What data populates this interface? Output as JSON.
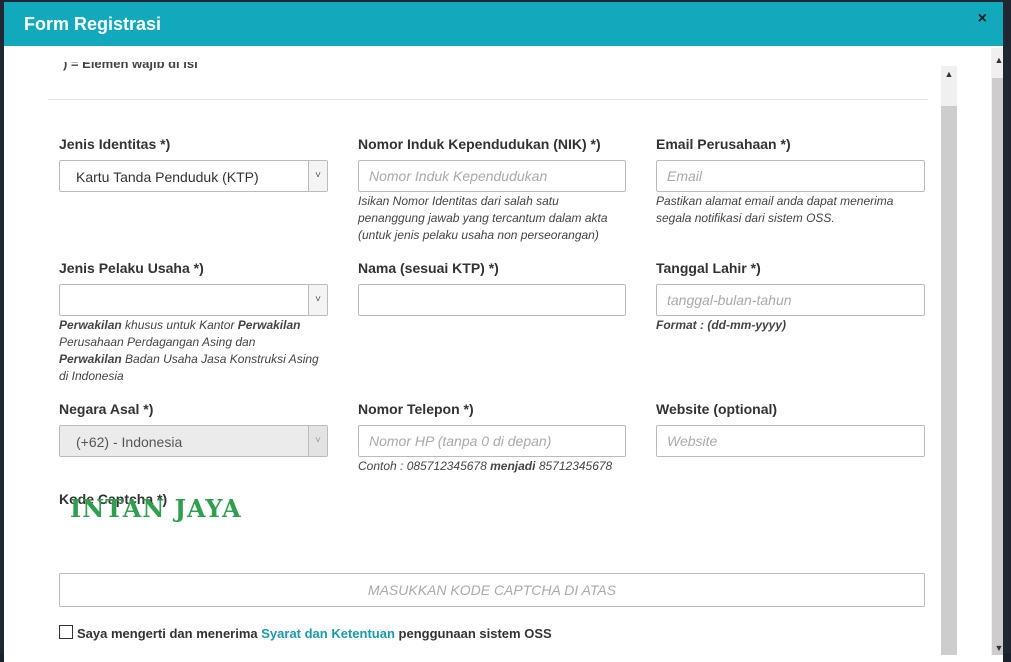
{
  "modal": {
    "title": "Form Registrasi",
    "close_icon": "close-icon",
    "close_glyph": "×"
  },
  "note_top": ") = Elemen wajib di isi",
  "fields": {
    "jenis_identitas": {
      "label": "Jenis Identitas *)",
      "value": "Kartu Tanda Penduduk (KTP)"
    },
    "nik": {
      "label": "Nomor Induk Kependudukan (NIK) *)",
      "placeholder": "Nomor Induk Kependudukan",
      "help": [
        "Isikan Nomor Identitas dari salah satu",
        "penanggung jawab yang tercantum dalam akta",
        "(untuk jenis pelaku usaha non perseorangan)"
      ]
    },
    "email": {
      "label": "Email Perusahaan *)",
      "placeholder": "Email",
      "help": [
        "Pastikan alamat email anda dapat menerima",
        "segala notifikasi dari sistem OSS."
      ]
    },
    "jenis_pelaku": {
      "label": "Jenis Pelaku Usaha *)",
      "value": "",
      "help_bold_1": "Perwakilan",
      "help_1": " khusus untuk Kantor ",
      "help_bold_2": "Perwakilan",
      "help_2": "Perusahaan Perdagangan Asing dan",
      "help_bold_3": "Perwakilan",
      "help_3": " Badan Usaha Jasa Konstruksi Asing",
      "help_4": "di Indonesia"
    },
    "nama": {
      "label": "Nama (sesuai KTP) *)",
      "placeholder": ""
    },
    "tanggal_lahir": {
      "label": "Tanggal Lahir *)",
      "placeholder": "tanggal-bulan-tahun",
      "help": "Format : (dd-mm-yyyy)"
    },
    "negara": {
      "label": "Negara Asal *)",
      "value": "(+62) - Indonesia"
    },
    "telepon": {
      "label": "Nomor Telepon *)",
      "placeholder": "Nomor HP (tanpa 0 di depan)",
      "help_a": "Contoh : 085712345678 ",
      "help_bold": "menjadi",
      "help_b": " 85712345678"
    },
    "website": {
      "label": "Website (optional)",
      "placeholder": "Website"
    },
    "captcha": {
      "label": "Kode Captcha *)",
      "image_text": "INTAN JAYA",
      "placeholder": "MASUKKAN KODE CAPTCHA DI ATAS"
    }
  },
  "terms": {
    "before": "Saya mengerti dan menerima ",
    "link": "Syarat dan Ketentuan",
    "after": " penggunaan sistem OSS"
  },
  "icons": {
    "select_arrow": "˅",
    "scroll_up": "▲",
    "scroll_down": "▼"
  }
}
